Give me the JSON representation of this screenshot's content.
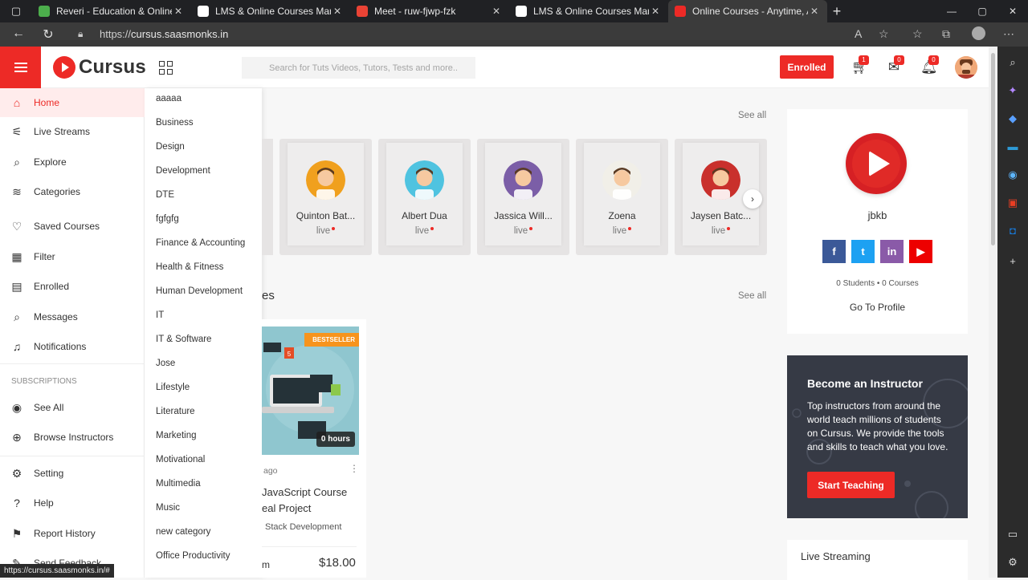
{
  "browser": {
    "tabs": [
      {
        "title": "Reveri - Education & Online Cou",
        "favicon_color": "#4cae4c"
      },
      {
        "title": "LMS & Online Courses Marketpla",
        "favicon_color": "#ffffff"
      },
      {
        "title": "Meet - ruw-fjwp-fzk",
        "favicon_color": "#ea4335"
      },
      {
        "title": "LMS & Online Courses Marketpla",
        "favicon_color": "#ffffff"
      },
      {
        "title": "Online Courses - Anytime, Anyw",
        "favicon_color": "#ed2a26"
      }
    ],
    "url_prefix": "https://",
    "url_host": "cursus.saasmonks.in",
    "status_url": "https://cursus.saasmonks.in/#"
  },
  "header": {
    "logo_text": "Cursus",
    "search_placeholder": "Search for Tuts Videos, Tutors, Tests and more..",
    "enrolled_label": "Enrolled",
    "cart_count": "1",
    "messages_count": "0",
    "notifications_count": "0"
  },
  "sidebar": {
    "items": [
      {
        "label": "Home",
        "icon": "home-icon",
        "active": true
      },
      {
        "label": "Live Streams",
        "icon": "live-streams-icon"
      },
      {
        "label": "Explore",
        "icon": "search-icon"
      },
      {
        "label": "Categories",
        "icon": "layers-icon"
      },
      {
        "label": "Saved Courses",
        "icon": "heart-icon"
      },
      {
        "label": "Filter",
        "icon": "filter-icon"
      },
      {
        "label": "Enrolled",
        "icon": "briefcase-icon"
      },
      {
        "label": "Messages",
        "icon": "messages-icon"
      },
      {
        "label": "Notifications",
        "icon": "bell-icon"
      }
    ],
    "subscriptions_heading": "SUBSCRIPTIONS",
    "sub_items": [
      {
        "label": "See All",
        "icon": "eye-icon"
      },
      {
        "label": "Browse Instructors",
        "icon": "plus-circle-icon"
      }
    ],
    "bottom_items": [
      {
        "label": "Setting",
        "icon": "gear-icon"
      },
      {
        "label": "Help",
        "icon": "help-icon"
      },
      {
        "label": "Report History",
        "icon": "flag-icon"
      },
      {
        "label": "Send Feedback",
        "icon": "feedback-icon"
      }
    ]
  },
  "categories": [
    "aaaaa",
    "Business",
    "Design",
    "Development",
    "DTE",
    "fgfgfg",
    "Finance & Accounting",
    "Health & Fitness",
    "Human Development",
    "IT",
    "IT & Software",
    "Jose",
    "Lifestyle",
    "Literature",
    "Marketing",
    "Motivational",
    "Multimedia",
    "Music",
    "new category",
    "Office Productivity"
  ],
  "live_section": {
    "see_all": "See all",
    "streams": [
      {
        "name": "Quinton Bat...",
        "status": "live",
        "face_color": "#f0a01e"
      },
      {
        "name": "Albert Dua",
        "status": "live",
        "face_color": "#4fc3e0"
      },
      {
        "name": "Jassica Will...",
        "status": "live",
        "face_color": "#7b5ea7"
      },
      {
        "name": "Zoena",
        "status": "live",
        "face_color": "#f1efe8"
      },
      {
        "name": "Jaysen Batc...",
        "status": "live",
        "face_color": "#c9302c"
      }
    ]
  },
  "courses_section": {
    "title_fragment": "es",
    "see_all": "See all",
    "course": {
      "badge": "BESTSELLER",
      "duration": "0 hours",
      "ago": "ago",
      "title": "JavaScript Course eal Project",
      "category": "Stack Development",
      "by": "m",
      "price": "$18.00"
    }
  },
  "profile": {
    "name": "jbkb",
    "students": "0 Students",
    "courses": "0 Courses",
    "link": "Go To Profile",
    "socials": [
      {
        "name": "facebook",
        "glyph": "f",
        "color": "#3b5998"
      },
      {
        "name": "twitter",
        "glyph": "t",
        "color": "#1da1f2"
      },
      {
        "name": "linkedin",
        "glyph": "in",
        "color": "#8a5aa8"
      },
      {
        "name": "youtube",
        "glyph": "▶",
        "color": "#ed0000"
      }
    ]
  },
  "instructor": {
    "title": "Become an Instructor",
    "text": "Top instructors from around the world teach millions of students on Cursus. We provide the tools and skills to teach what you love.",
    "button": "Start Teaching"
  },
  "live_streaming_title": "Live Streaming"
}
